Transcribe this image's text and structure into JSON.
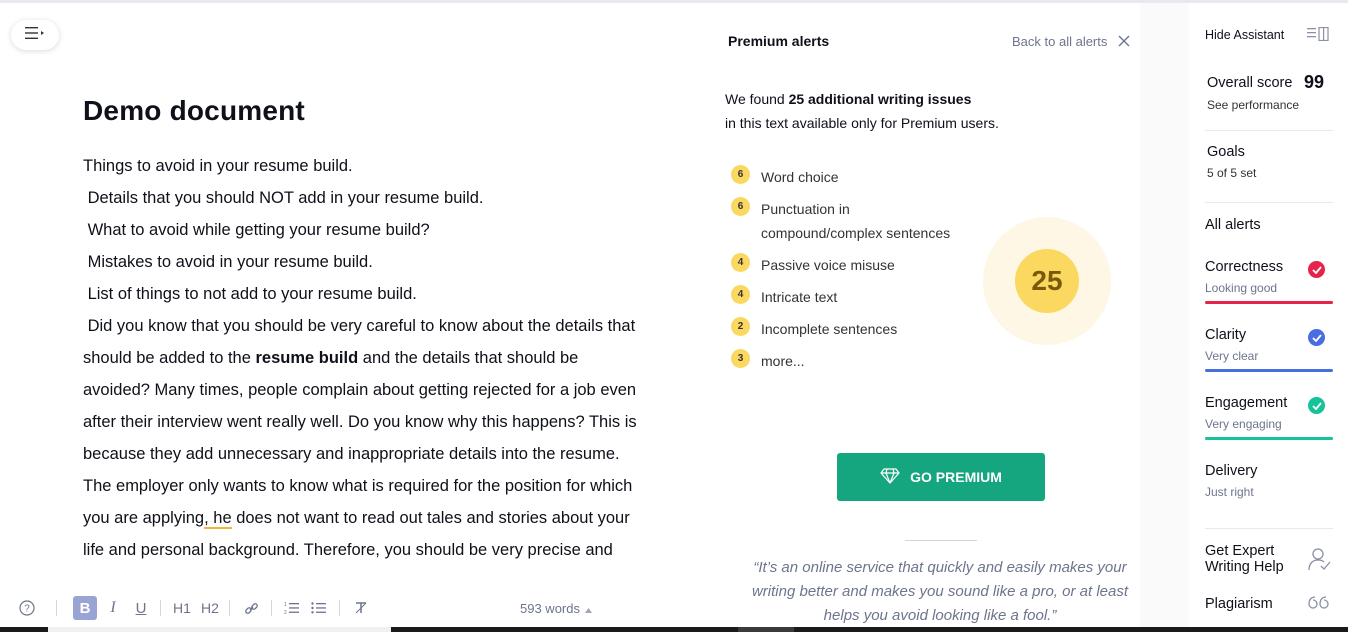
{
  "document": {
    "title": "Demo document",
    "lines": [
      "Things to avoid in your resume build.",
      " Details that you should NOT add in your resume build.",
      " What to avoid while getting your resume build?",
      " Mistakes to avoid in your resume build.",
      " List of things to not add to your resume build."
    ],
    "para_start": " Did you know that you should be very careful to know about the details that should be added to the ",
    "para_bold": "resume build",
    "para_mid": " and the details that should be avoided? Many times, people complain about getting rejected for a job even after their interview went really well. Do you know why this happens? This is because they add unnecessary and inappropriate details into the resume. The employer only wants to know what is required for the position for which you are applying",
    "para_underlined": ", he",
    "para_end": " does not want to read out tales and stories about your life and personal background. Therefore, you should be very precise and"
  },
  "toolbar": {
    "help_icon": "help-circle-icon",
    "bold": "B",
    "italic": "I",
    "underline": "U",
    "h1": "H1",
    "h2": "H2",
    "word_count": "593 words"
  },
  "premium_panel": {
    "title": "Premium alerts",
    "back_label": "Back to all alerts",
    "found_prefix": "We found ",
    "found_bold": "25 additional writing issues",
    "found_suffix": "in this text available only for Premium users.",
    "issues": [
      {
        "count": "6",
        "label": "Word choice"
      },
      {
        "count": "6",
        "label": "Punctuation in compound/complex sentences"
      },
      {
        "count": "4",
        "label": "Passive voice misuse"
      },
      {
        "count": "4",
        "label": "Intricate text"
      },
      {
        "count": "2",
        "label": "Incomplete sentences"
      },
      {
        "count": "3",
        "label": "more..."
      }
    ],
    "total": "25",
    "cta": "GO PREMIUM",
    "quote": "“It’s an online service that quickly and easily makes your writing better and makes you sound like a pro, or at least helps you avoid looking like a fool.”"
  },
  "sidebar": {
    "hide_assistant": "Hide Assistant",
    "overall_label": "Overall score",
    "overall_score": "99",
    "see_performance": "See performance",
    "goals_label": "Goals",
    "goals_sub": "5 of 5 set",
    "all_alerts": "All alerts",
    "categories": [
      {
        "name": "Correctness",
        "status": "Looking good",
        "color": "#e5234b"
      },
      {
        "name": "Clarity",
        "status": "Very clear",
        "color": "#4a6ee0"
      },
      {
        "name": "Engagement",
        "status": "Very engaging",
        "color": "#15c39a"
      },
      {
        "name": "Delivery",
        "status": "Just right",
        "color": ""
      }
    ],
    "expert_help": "Get Expert Writing Help",
    "plagiarism": "Plagiarism"
  },
  "colors": {
    "brand_green": "#15a57f",
    "badge_yellow": "#fbd85f",
    "correctness_red": "#e5234b",
    "clarity_blue": "#4a6ee0",
    "engagement_green": "#15c39a"
  }
}
